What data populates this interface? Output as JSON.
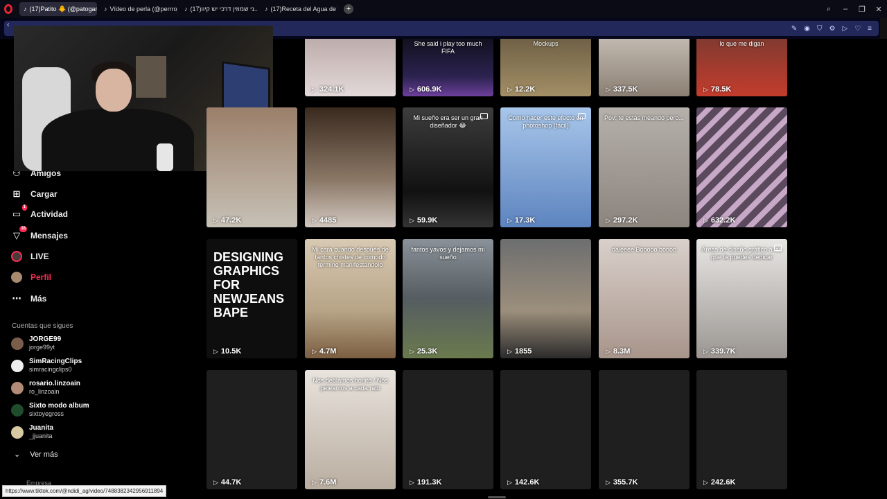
{
  "tabs": [
    {
      "title": "(17)Patito 🐥 (@patogarc...",
      "active": true
    },
    {
      "title": "Vídeo de perla (@perrroja...",
      "active": false
    },
    {
      "title": "(17)ני שמוזין דרכי יש קיוו...",
      "active": false
    },
    {
      "title": "(17)Receta del Agua de Te...",
      "active": false
    }
  ],
  "nav": {
    "amigos": "Amigos",
    "cargar": "Cargar",
    "actividad": "Actividad",
    "actividad_badge": "1",
    "mensajes": "Mensajes",
    "mensajes_badge": "16",
    "live": "LIVE",
    "perfil": "Perfil",
    "mas": "Más"
  },
  "following": {
    "title": "Cuentas que sigues",
    "accounts": [
      {
        "name": "JORGE99",
        "user": "jorge99yt",
        "color": "#7a5c4b"
      },
      {
        "name": "SimRacingClips",
        "user": "simracingclips0",
        "color": "#eeeeee"
      },
      {
        "name": "rosario.linzoain",
        "user": "ro_linzoain",
        "color": "#b38a76"
      },
      {
        "name": "Sixto modo album",
        "user": "sixtoyegross",
        "color": "#1f4d2b"
      },
      {
        "name": "Juanita",
        "user": "_jjuanita",
        "color": "#d9c9a3"
      }
    ],
    "see_more": "Ver más",
    "footer": "Empresa"
  },
  "videos": [
    {
      "views": "324.1K",
      "caption": "",
      "bg": "linear-gradient(180deg,#b9a7a6,#e2d9d8)"
    },
    {
      "views": "606.9K",
      "caption": "She said i play too much FIFA",
      "bg": "linear-gradient(180deg,#0d0d16,#2c2350 70%,#6d3f9c)"
    },
    {
      "views": "12.2K",
      "caption": "Mockups",
      "bg": "linear-gradient(180deg,#6a5c43,#a38f66)"
    },
    {
      "views": "337.5K",
      "caption": "",
      "bg": "linear-gradient(180deg,#c7c0b6,#8b7f73)"
    },
    {
      "views": "78.5K",
      "caption": "lo que me digan",
      "bg": "linear-gradient(180deg,#7a3a30,#c33c2d)"
    },
    {
      "views": "47.2K",
      "caption": "",
      "bg": "linear-gradient(180deg,#9b7f6a,#c7c1b6)"
    },
    {
      "views": "4485",
      "caption": "",
      "bg": "linear-gradient(180deg,#3a2a1e,#8a7766 60%,#d1c7bf)"
    },
    {
      "views": "59.9K",
      "caption": "Mi sueño era ser un gran diseñador 😂",
      "bg": "linear-gradient(180deg,#3d3d3d,#111 70%,#333)"
    },
    {
      "views": "17.3K",
      "caption": "Como hacer este efecto en photoshop (fácil)",
      "bg": "linear-gradient(180deg,#a8c6ea,#5d84bf)"
    },
    {
      "views": "297.2K",
      "caption": "Pov: te estás meando pero...",
      "bg": "linear-gradient(180deg,#b6b0ab,#8c857e)"
    },
    {
      "views": "632.2K",
      "caption": "",
      "bg": "repeating-linear-gradient(135deg,#5b4a5e 0 10px,#c7a8c6 10px 18px)"
    },
    {
      "views": "10.5K",
      "caption": "DESIGNING GRAPHICS FOR NEWJEANS BAPE",
      "bg": "#0e0e0e"
    },
    {
      "views": "4.7M",
      "caption": "Mi cara cuando después de tantos chistes de comodo termine manifestandolo",
      "bg": "linear-gradient(180deg,#d8c9b3,#b7a487 60%,#7c5f42)"
    },
    {
      "views": "25.3K",
      "caption": "fantos yavos y dejamos mi sueño",
      "bg": "linear-gradient(180deg,#8a9198,#555d62 50%,#6a7a4d)"
    },
    {
      "views": "1855",
      "caption": "",
      "bg": "linear-gradient(180deg,#6d6e70,#9c8f7c 60%,#2b2b2b)"
    },
    {
      "views": "8.3M",
      "caption": "daleeee Booooo boooo",
      "bg": "linear-gradient(180deg,#d9d0cb,#a8958b)"
    },
    {
      "views": "339.7K",
      "caption": "Áreas de diseño gráfico a las que te puedes dedicar",
      "bg": "linear-gradient(180deg,#e8e6e3,#9b9692)"
    },
    {
      "views": "44.7K",
      "caption": "",
      "bg": "#1f1f1f"
    },
    {
      "views": "7.6M",
      "caption": "Nos debíamos bonito / Nos peleamos a cada rato",
      "bg": "linear-gradient(180deg,#e8e3dd,#b9ada0)"
    },
    {
      "views": "191.3K",
      "caption": "",
      "bg": "#1f1f1f"
    },
    {
      "views": "142.6K",
      "caption": "",
      "bg": "#1f1f1f"
    },
    {
      "views": "355.7K",
      "caption": "",
      "bg": "#1f1f1f"
    },
    {
      "views": "242.6K",
      "caption": "",
      "bg": "#1f1f1f"
    }
  ],
  "status_url": "https://www.tiktok.com/@ndidi_ag/video/7488382342956911894"
}
